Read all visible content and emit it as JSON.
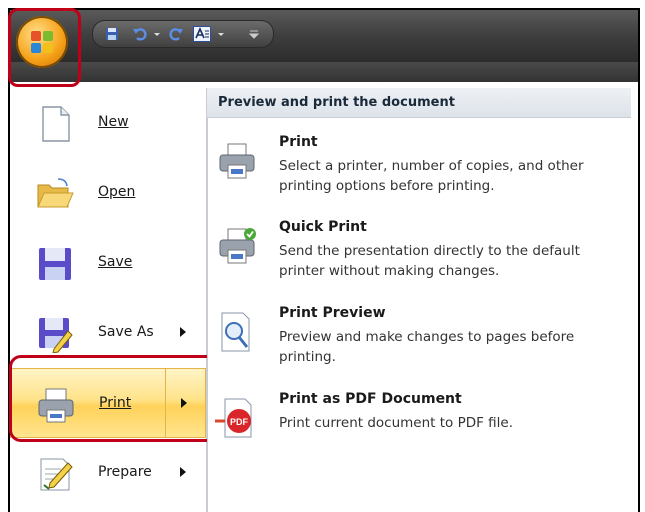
{
  "menu": {
    "items": [
      {
        "label": "New",
        "access_key": "N"
      },
      {
        "label": "Open",
        "access_key": "O"
      },
      {
        "label": "Save",
        "access_key": "S"
      },
      {
        "label": "Save As",
        "access_key": "A"
      },
      {
        "label": "Print",
        "access_key": "P"
      },
      {
        "label": "Prepare",
        "access_key": "E"
      }
    ]
  },
  "right_pane": {
    "title": "Preview and print the document",
    "options": [
      {
        "head": "Print",
        "desc": "Select a printer, number of copies, and other printing options before printing."
      },
      {
        "head": "Quick Print",
        "desc": "Send the presentation directly to the default printer without making changes."
      },
      {
        "head": "Print Preview",
        "desc": "Preview and make changes to pages before printing."
      },
      {
        "head": "Print as PDF Document",
        "desc": "Print current document to PDF file."
      }
    ]
  },
  "colors": {
    "highlight": "#c00018",
    "active_item": "#ffe38a",
    "titlebar": "#3e3e3e"
  }
}
